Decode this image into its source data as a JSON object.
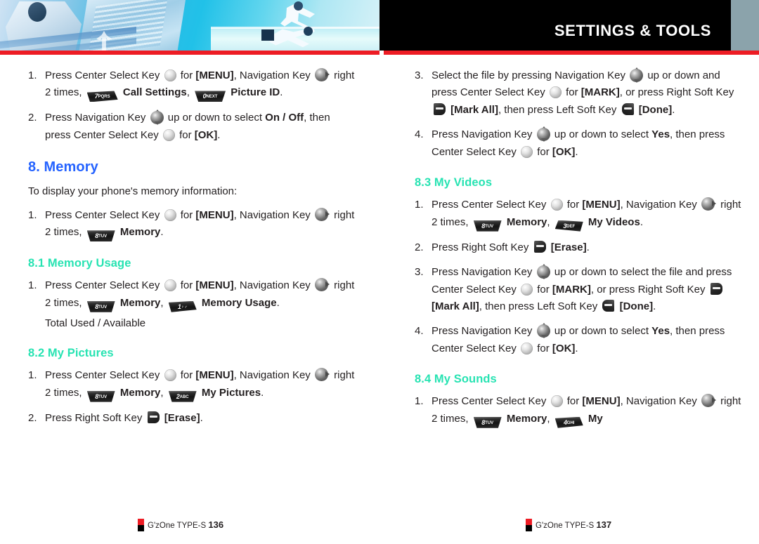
{
  "header": {
    "title": "SETTINGS & TOOLS",
    "accent_red": "#ed1c24",
    "band_black": "#000000",
    "band_grey": "#8ba3ab"
  },
  "colors": {
    "section_heading": "#2563ff",
    "subsection_heading": "#27e3b2",
    "body_text": "#231f20"
  },
  "left_column": {
    "continued_steps": [
      {
        "num": "1.",
        "parts": [
          {
            "t": "text",
            "v": "Press Center Select Key "
          },
          {
            "t": "icon",
            "v": "center-select-key"
          },
          {
            "t": "text",
            "v": " for "
          },
          {
            "t": "bold",
            "v": "[MENU]"
          },
          {
            "t": "text",
            "v": ", Navigation Key "
          },
          {
            "t": "icon",
            "v": "navigation-key-right"
          },
          {
            "t": "text",
            "v": " right 2 times, "
          },
          {
            "t": "key",
            "v": "7",
            "sub": "PQRS",
            "shape": "slant-l"
          },
          {
            "t": "bold",
            "v": " Call Settings"
          },
          {
            "t": "text",
            "v": ", "
          },
          {
            "t": "key",
            "v": "0",
            "sub": "NEXT",
            "shape": "trap"
          },
          {
            "t": "bold",
            "v": " Picture ID"
          },
          {
            "t": "text",
            "v": "."
          }
        ]
      },
      {
        "num": "2.",
        "parts": [
          {
            "t": "text",
            "v": "Press Navigation Key "
          },
          {
            "t": "icon",
            "v": "navigation-key-up-down"
          },
          {
            "t": "text",
            "v": " up or down to select "
          },
          {
            "t": "bold",
            "v": "On / Off"
          },
          {
            "t": "text",
            "v": ", then press Center Select Key "
          },
          {
            "t": "icon",
            "v": "center-select-key"
          },
          {
            "t": "text",
            "v": " for "
          },
          {
            "t": "bold",
            "v": "[OK]"
          },
          {
            "t": "text",
            "v": "."
          }
        ]
      }
    ],
    "section": {
      "heading": "8. Memory",
      "intro": "To display your phone's memory information:",
      "steps": [
        {
          "num": "1.",
          "parts": [
            {
              "t": "text",
              "v": "Press Center Select Key "
            },
            {
              "t": "icon",
              "v": "center-select-key"
            },
            {
              "t": "text",
              "v": " for "
            },
            {
              "t": "bold",
              "v": "[MENU]"
            },
            {
              "t": "text",
              "v": ", Navigation Key "
            },
            {
              "t": "icon",
              "v": "navigation-key-right"
            },
            {
              "t": "text",
              "v": " right 2 times, "
            },
            {
              "t": "key",
              "v": "8",
              "sub": "TUV",
              "shape": "trap"
            },
            {
              "t": "bold",
              "v": " Memory"
            },
            {
              "t": "text",
              "v": "."
            }
          ]
        }
      ]
    },
    "subsections": [
      {
        "heading": "8.1 Memory Usage",
        "steps": [
          {
            "num": "1.",
            "parts": [
              {
                "t": "text",
                "v": "Press Center Select Key "
              },
              {
                "t": "icon",
                "v": "center-select-key"
              },
              {
                "t": "text",
                "v": " for "
              },
              {
                "t": "bold",
                "v": "[MENU]"
              },
              {
                "t": "text",
                "v": ", Navigation Key "
              },
              {
                "t": "icon",
                "v": "navigation-key-right"
              },
              {
                "t": "text",
                "v": " right 2 times, "
              },
              {
                "t": "key",
                "v": "8",
                "sub": "TUV",
                "shape": "trap"
              },
              {
                "t": "bold",
                "v": " Memory"
              },
              {
                "t": "text",
                "v": ", "
              },
              {
                "t": "key",
                "v": "1",
                "sub": "♀♂",
                "shape": "slant-l"
              },
              {
                "t": "bold",
                "v": " Memory Usage"
              },
              {
                "t": "text",
                "v": "."
              }
            ]
          }
        ],
        "note": "Total Used / Available"
      },
      {
        "heading": "8.2 My Pictures",
        "steps": [
          {
            "num": "1.",
            "parts": [
              {
                "t": "text",
                "v": "Press Center Select Key "
              },
              {
                "t": "icon",
                "v": "center-select-key"
              },
              {
                "t": "text",
                "v": " for "
              },
              {
                "t": "bold",
                "v": "[MENU]"
              },
              {
                "t": "text",
                "v": ", Navigation Key "
              },
              {
                "t": "icon",
                "v": "navigation-key-right"
              },
              {
                "t": "text",
                "v": " right 2 times, "
              },
              {
                "t": "key",
                "v": "8",
                "sub": "TUV",
                "shape": "trap"
              },
              {
                "t": "bold",
                "v": " Memory"
              },
              {
                "t": "text",
                "v": ", "
              },
              {
                "t": "key",
                "v": "2",
                "sub": "ABC",
                "shape": "trap"
              },
              {
                "t": "bold",
                "v": " My Pictures"
              },
              {
                "t": "text",
                "v": "."
              }
            ]
          },
          {
            "num": "2.",
            "parts": [
              {
                "t": "text",
                "v": "Press Right Soft Key "
              },
              {
                "t": "icon",
                "v": "right-soft-key"
              },
              {
                "t": "bold",
                "v": " [Erase]"
              },
              {
                "t": "text",
                "v": "."
              }
            ]
          }
        ],
        "note": ""
      }
    ],
    "footer": {
      "brand": "G'zOne TYPE-S",
      "page": "136"
    }
  },
  "right_column": {
    "continued_steps": [
      {
        "num": "3.",
        "parts": [
          {
            "t": "text",
            "v": "Select the file by pressing Navigation Key "
          },
          {
            "t": "icon",
            "v": "navigation-key-up-down"
          },
          {
            "t": "text",
            "v": " up or down and press Center Select Key "
          },
          {
            "t": "icon",
            "v": "center-select-key"
          },
          {
            "t": "text",
            "v": " for "
          },
          {
            "t": "bold",
            "v": "[MARK]"
          },
          {
            "t": "text",
            "v": ", or press Right Soft Key "
          },
          {
            "t": "icon",
            "v": "right-soft-key"
          },
          {
            "t": "bold",
            "v": " [Mark All]"
          },
          {
            "t": "text",
            "v": ", then press Left Soft Key "
          },
          {
            "t": "icon",
            "v": "left-soft-key"
          },
          {
            "t": "bold",
            "v": " [Done]"
          },
          {
            "t": "text",
            "v": "."
          }
        ]
      },
      {
        "num": "4.",
        "parts": [
          {
            "t": "text",
            "v": "Press Navigation Key "
          },
          {
            "t": "icon",
            "v": "navigation-key-up-down"
          },
          {
            "t": "text",
            "v": " up or down to select "
          },
          {
            "t": "bold",
            "v": "Yes"
          },
          {
            "t": "text",
            "v": ", then press Center Select Key "
          },
          {
            "t": "icon",
            "v": "center-select-key"
          },
          {
            "t": "text",
            "v": " for "
          },
          {
            "t": "bold",
            "v": "[OK]"
          },
          {
            "t": "text",
            "v": "."
          }
        ]
      }
    ],
    "subsections": [
      {
        "heading": "8.3 My Videos",
        "steps": [
          {
            "num": "1.",
            "parts": [
              {
                "t": "text",
                "v": "Press Center Select Key "
              },
              {
                "t": "icon",
                "v": "center-select-key"
              },
              {
                "t": "text",
                "v": " for "
              },
              {
                "t": "bold",
                "v": "[MENU]"
              },
              {
                "t": "text",
                "v": ", Navigation Key "
              },
              {
                "t": "icon",
                "v": "navigation-key-right"
              },
              {
                "t": "text",
                "v": " right 2 times, "
              },
              {
                "t": "key",
                "v": "8",
                "sub": "TUV",
                "shape": "trap"
              },
              {
                "t": "bold",
                "v": " Memory"
              },
              {
                "t": "text",
                "v": ", "
              },
              {
                "t": "key",
                "v": "3",
                "sub": "DEF",
                "shape": "slant-r"
              },
              {
                "t": "bold",
                "v": " My Videos"
              },
              {
                "t": "text",
                "v": "."
              }
            ]
          },
          {
            "num": "2.",
            "parts": [
              {
                "t": "text",
                "v": "Press Right Soft Key "
              },
              {
                "t": "icon",
                "v": "right-soft-key"
              },
              {
                "t": "bold",
                "v": " [Erase]"
              },
              {
                "t": "text",
                "v": "."
              }
            ]
          },
          {
            "num": "3.",
            "parts": [
              {
                "t": "text",
                "v": "Press Navigation Key "
              },
              {
                "t": "icon",
                "v": "navigation-key-up-down"
              },
              {
                "t": "text",
                "v": " up or down to select the file and press Center Select Key "
              },
              {
                "t": "icon",
                "v": "center-select-key"
              },
              {
                "t": "text",
                "v": " for "
              },
              {
                "t": "bold",
                "v": "[MARK]"
              },
              {
                "t": "text",
                "v": ", or press Right Soft Key "
              },
              {
                "t": "icon",
                "v": "right-soft-key"
              },
              {
                "t": "bold",
                "v": " [Mark All]"
              },
              {
                "t": "text",
                "v": ", then press Left Soft Key "
              },
              {
                "t": "icon",
                "v": "left-soft-key"
              },
              {
                "t": "bold",
                "v": " [Done]"
              },
              {
                "t": "text",
                "v": "."
              }
            ]
          },
          {
            "num": "4.",
            "parts": [
              {
                "t": "text",
                "v": "Press Navigation Key "
              },
              {
                "t": "icon",
                "v": "navigation-key-up-down"
              },
              {
                "t": "text",
                "v": " up or down to select "
              },
              {
                "t": "bold",
                "v": "Yes"
              },
              {
                "t": "text",
                "v": ", then press Center Select Key "
              },
              {
                "t": "icon",
                "v": "center-select-key"
              },
              {
                "t": "text",
                "v": " for "
              },
              {
                "t": "bold",
                "v": "[OK]"
              },
              {
                "t": "text",
                "v": "."
              }
            ]
          }
        ],
        "note": ""
      },
      {
        "heading": "8.4 My Sounds",
        "steps": [
          {
            "num": "1.",
            "parts": [
              {
                "t": "text",
                "v": "Press Center Select Key "
              },
              {
                "t": "icon",
                "v": "center-select-key"
              },
              {
                "t": "text",
                "v": " for "
              },
              {
                "t": "bold",
                "v": "[MENU]"
              },
              {
                "t": "text",
                "v": ", Navigation Key "
              },
              {
                "t": "icon",
                "v": "navigation-key-right"
              },
              {
                "t": "text",
                "v": " right 2 times, "
              },
              {
                "t": "key",
                "v": "8",
                "sub": "TUV",
                "shape": "trap"
              },
              {
                "t": "bold",
                "v": " Memory"
              },
              {
                "t": "text",
                "v": ", "
              },
              {
                "t": "key",
                "v": "4",
                "sub": "GHI",
                "shape": "slant-l"
              },
              {
                "t": "bold",
                "v": " My"
              }
            ]
          }
        ],
        "note": ""
      }
    ],
    "footer": {
      "brand": "G'zOne TYPE-S",
      "page": "137"
    }
  }
}
